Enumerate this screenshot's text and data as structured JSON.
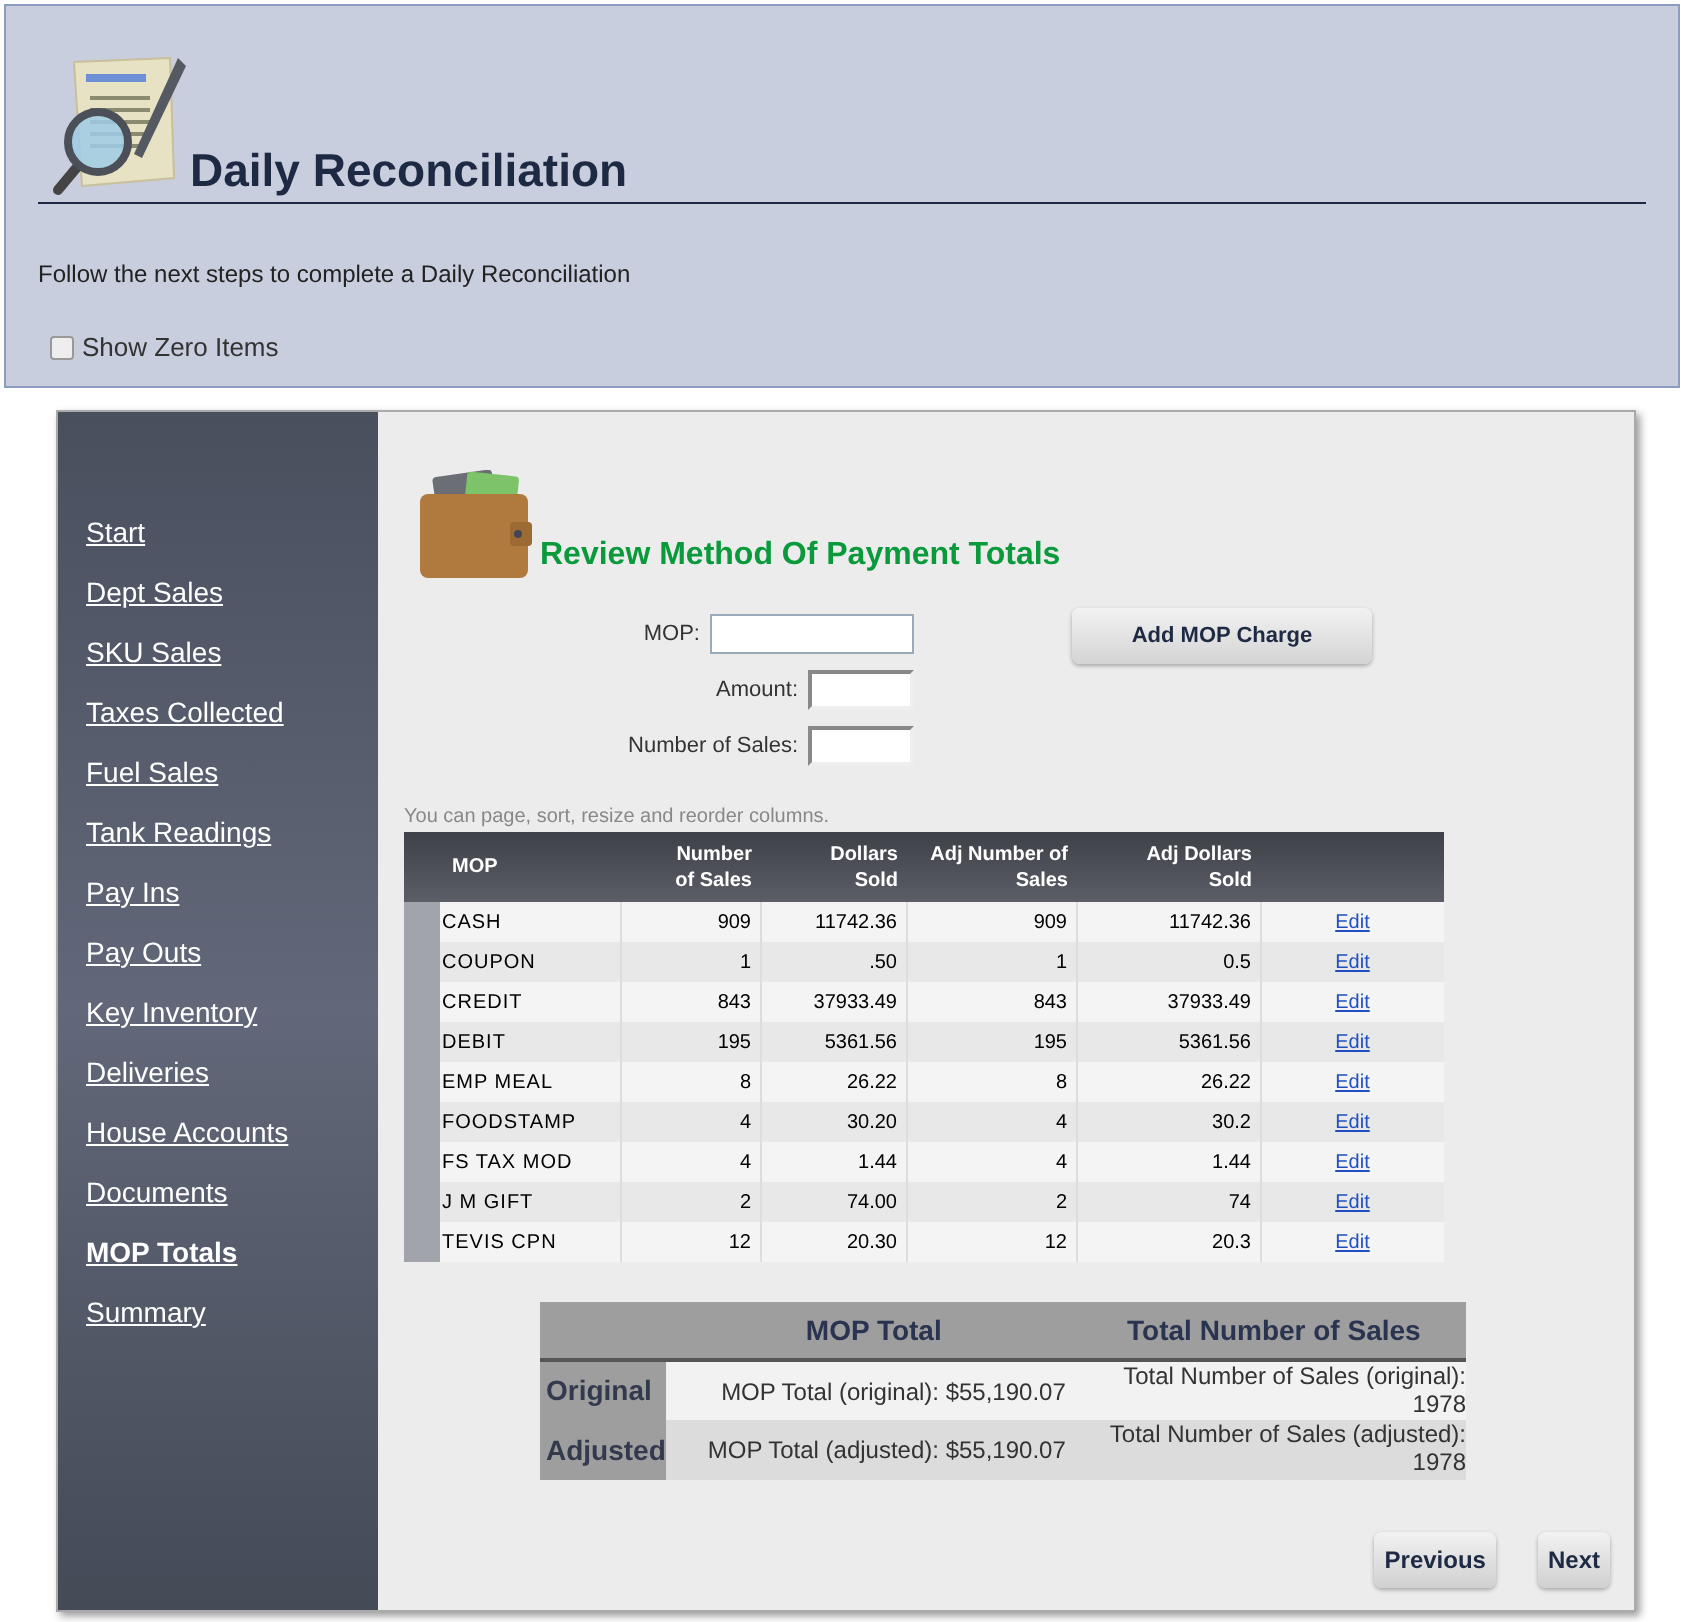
{
  "header": {
    "title": "Daily Reconciliation",
    "instructions": "Follow the next steps to complete a Daily Reconciliation",
    "show_zero_items": {
      "label": "Show Zero Items",
      "checked": false
    }
  },
  "sidebar": {
    "items": [
      {
        "label": "Start",
        "selected": false
      },
      {
        "label": "Dept Sales",
        "selected": false
      },
      {
        "label": "SKU Sales",
        "selected": false
      },
      {
        "label": "Taxes Collected",
        "selected": false
      },
      {
        "label": "Fuel Sales",
        "selected": false
      },
      {
        "label": "Tank Readings",
        "selected": false
      },
      {
        "label": "Pay Ins",
        "selected": false
      },
      {
        "label": "Pay Outs",
        "selected": false
      },
      {
        "label": "Key Inventory",
        "selected": false
      },
      {
        "label": "Deliveries",
        "selected": false
      },
      {
        "label": "House Accounts",
        "selected": false
      },
      {
        "label": "Documents",
        "selected": false
      },
      {
        "label": "MOP Totals",
        "selected": true
      },
      {
        "label": "Summary",
        "selected": false
      }
    ]
  },
  "section": {
    "title": "Review Method Of Payment Totals",
    "form": {
      "fields": [
        {
          "label": "MOP:",
          "kind": "wide"
        },
        {
          "label": "Amount:",
          "kind": "narrow"
        },
        {
          "label": "Number of Sales:",
          "kind": "narrow"
        }
      ],
      "add_button": "Add MOP Charge"
    },
    "hint": "You can page, sort, resize and reorder columns.",
    "table": {
      "columns": [
        "MOP",
        "Number of Sales",
        "Dollars Sold",
        "Adj Number of Sales",
        "Adj Dollars Sold"
      ],
      "rows": [
        {
          "mop": "CASH",
          "number": "909",
          "dollars": "11742.36",
          "adj_number": "909",
          "adj_dollars": "11742.36",
          "action": "Edit"
        },
        {
          "mop": "COUPON",
          "number": "1",
          "dollars": ".50",
          "adj_number": "1",
          "adj_dollars": "0.5",
          "action": "Edit"
        },
        {
          "mop": "CREDIT",
          "number": "843",
          "dollars": "37933.49",
          "adj_number": "843",
          "adj_dollars": "37933.49",
          "action": "Edit"
        },
        {
          "mop": "DEBIT",
          "number": "195",
          "dollars": "5361.56",
          "adj_number": "195",
          "adj_dollars": "5361.56",
          "action": "Edit"
        },
        {
          "mop": "EMP MEAL",
          "number": "8",
          "dollars": "26.22",
          "adj_number": "8",
          "adj_dollars": "26.22",
          "action": "Edit"
        },
        {
          "mop": "FOODSTAMP",
          "number": "4",
          "dollars": "30.20",
          "adj_number": "4",
          "adj_dollars": "30.2",
          "action": "Edit"
        },
        {
          "mop": "FS TAX MOD",
          "number": "4",
          "dollars": "1.44",
          "adj_number": "4",
          "adj_dollars": "1.44",
          "action": "Edit"
        },
        {
          "mop": "J M GIFT",
          "number": "2",
          "dollars": "74.00",
          "adj_number": "2",
          "adj_dollars": "74",
          "action": "Edit"
        },
        {
          "mop": "TEVIS CPN",
          "number": "12",
          "dollars": "20.30",
          "adj_number": "12",
          "adj_dollars": "20.3",
          "action": "Edit"
        }
      ]
    },
    "summary": {
      "columns": [
        "MOP Total",
        "Total Number of Sales"
      ],
      "rows": [
        {
          "label": "Original",
          "mop_total": "MOP Total (original): $55,190.07",
          "sales_label": "Total Number of Sales (original):",
          "sales_value": "1978"
        },
        {
          "label": "Adjusted",
          "mop_total": "MOP Total (adjusted): $55,190.07",
          "sales_label": "Total Number of Sales (adjusted):",
          "sales_value": "1978"
        }
      ]
    },
    "nav": {
      "previous": "Previous",
      "next": "Next"
    }
  }
}
